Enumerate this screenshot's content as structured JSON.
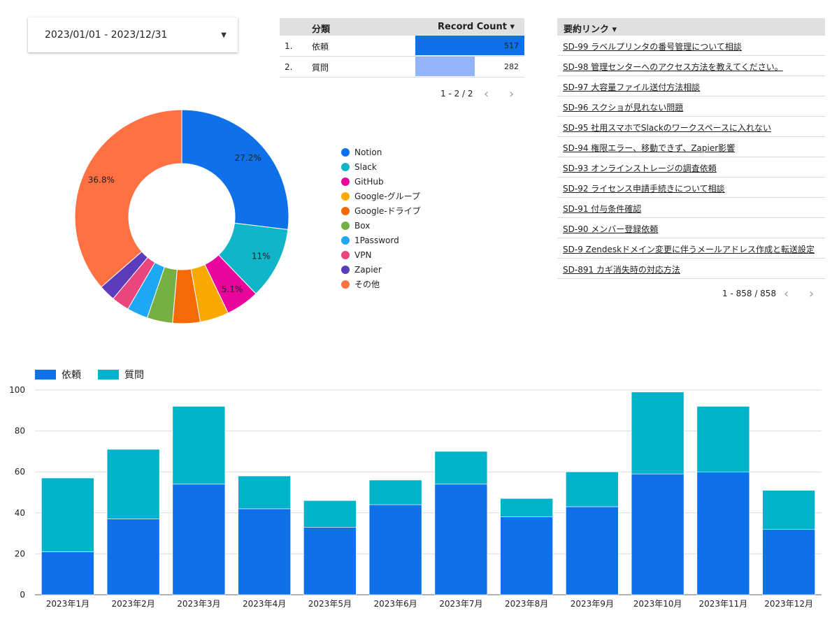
{
  "date_range": {
    "label": "2023/01/01 - 2023/12/31"
  },
  "category_table": {
    "headers": [
      "分類",
      "Record Count ▾"
    ],
    "rows": [
      {
        "num": "1.",
        "label": "依頼",
        "value": 517,
        "color": "#0f71ea"
      },
      {
        "num": "2.",
        "label": "質問",
        "value": 282,
        "color": "#93b3fa"
      }
    ],
    "pager": "1 - 2 / 2"
  },
  "summary_table": {
    "header": "要約リンク ▾",
    "links": [
      "SD-99 ラベルプリンタの番号管理について相談",
      "SD-98 管理センターへのアクセス方法を教えてください。",
      "SD-97 大容量ファイル送付方法相談",
      "SD-96 スクショが見れない問題",
      "SD-95 社用スマホでSlackのワークスペースに入れない",
      "SD-94 権限エラー、移動できず、Zapier影響",
      "SD-93 オンラインストレージの調査依頼",
      "SD-92 ライセンス申請手続きについて相談",
      "SD-91 付与条件確認",
      "SD-90 メンバー登録依頼",
      "SD-9 Zendeskドメイン変更に伴うメールアドレス作成と転送設定",
      "SD-891 カギ消失時の対応方法"
    ],
    "pager": "1 - 858 / 858"
  },
  "chart_data": [
    {
      "type": "pie",
      "donut": true,
      "slices": [
        {
          "label": "Notion",
          "value": 27.2,
          "color": "#0f71ea",
          "shown_label": "27.2%"
        },
        {
          "label": "Slack",
          "value": 11.0,
          "color": "#11b5c8",
          "shown_label": "11%"
        },
        {
          "label": "GitHub",
          "value": 5.1,
          "color": "#e9059c",
          "shown_label": "5.1%"
        },
        {
          "label": "Google-グループ",
          "value": 4.4,
          "color": "#fba800",
          "shown_label": ""
        },
        {
          "label": "Google-ドライブ",
          "value": 4.2,
          "color": "#f46b06",
          "shown_label": ""
        },
        {
          "label": "Box",
          "value": 3.9,
          "color": "#77b042",
          "shown_label": ""
        },
        {
          "label": "1Password",
          "value": 3.2,
          "color": "#1ea7f2",
          "shown_label": ""
        },
        {
          "label": "VPN",
          "value": 2.7,
          "color": "#e8467c",
          "shown_label": ""
        },
        {
          "label": "Zapier",
          "value": 2.5,
          "color": "#5b3cbc",
          "shown_label": ""
        },
        {
          "label": "その他",
          "value": 36.8,
          "color": "#ff7043",
          "shown_label": "36.8%"
        }
      ]
    },
    {
      "type": "bar",
      "stacked": true,
      "categories": [
        "2023年1月",
        "2023年2月",
        "2023年3月",
        "2023年4月",
        "2023年5月",
        "2023年6月",
        "2023年7月",
        "2023年8月",
        "2023年9月",
        "2023年10月",
        "2023年11月",
        "2023年12月"
      ],
      "series": [
        {
          "name": "依頼",
          "color": "#0f71ea",
          "values": [
            21,
            37,
            54,
            42,
            33,
            44,
            54,
            38,
            43,
            59,
            60,
            32
          ]
        },
        {
          "name": "質問",
          "color": "#00b2ca",
          "values": [
            36,
            34,
            38,
            16,
            13,
            12,
            16,
            9,
            17,
            40,
            32,
            19
          ]
        }
      ],
      "ylim": [
        0,
        100
      ],
      "yticks": [
        0,
        20,
        40,
        60,
        80,
        100
      ],
      "grid": true,
      "legend": "top-left"
    }
  ]
}
